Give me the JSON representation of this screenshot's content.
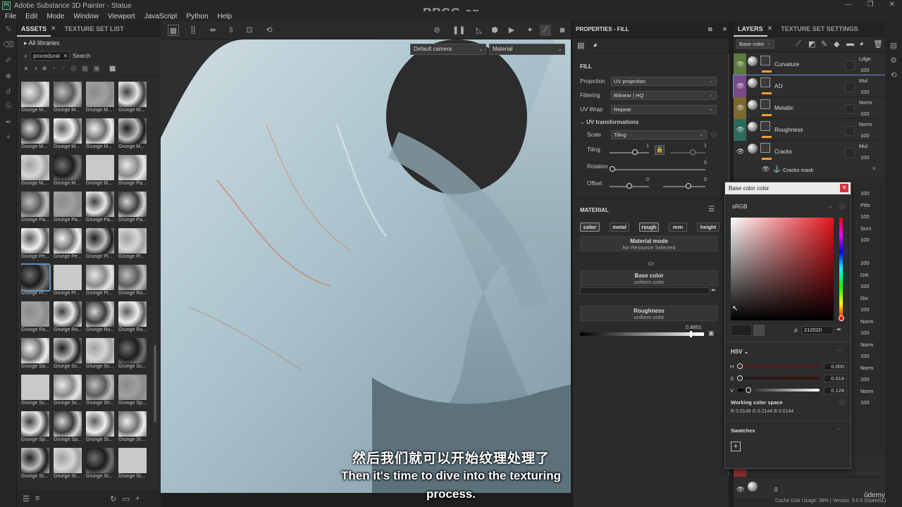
{
  "titlebar": {
    "app_title": "Adobe Substance 3D Painter - Statue",
    "logo": "Pt",
    "buttons": [
      "—",
      "❐",
      "✕"
    ]
  },
  "menu": [
    "File",
    "Edit",
    "Mode",
    "Window",
    "Viewport",
    "JavaScript",
    "Python",
    "Help"
  ],
  "watermark": "RRCG.cn",
  "assets": {
    "tabs": [
      "ASSETS",
      "TEXTURE SET LIST"
    ],
    "all_libraries": "All libraries",
    "search_value": "procedural",
    "search_label": "Search",
    "thumbnails": [
      "Grunge M...",
      "Grunge M...",
      "Grunge M...",
      "Grunge M...",
      "Grunge M...",
      "Grunge M...",
      "Grunge M...",
      "Grunge M...",
      "Grunge M...",
      "Grunge M...",
      "Grunge M...",
      "Grunge Pa...",
      "Grunge Pa...",
      "Grunge Pa...",
      "Grunge Pa...",
      "Grunge Pa...",
      "Grunge Pe...",
      "Grunge Pe...",
      "Grunge Pl...",
      "Grunge Pl...",
      "Grunge Pl...",
      "Grunge Pl...",
      "Grunge Pl...",
      "Grunge Ro...",
      "Grunge Ro...",
      "Grunge Ro...",
      "Grunge Ru...",
      "Grunge Ru...",
      "Grunge Sa...",
      "Grunge Sc...",
      "Grunge Sc...",
      "Grunge Sc...",
      "Grunge Sc...",
      "Grunge Sc...",
      "Grunge Sh...",
      "Grunge Sp...",
      "Grunge Sp...",
      "Grunge Sp...",
      "Grunge St...",
      "Grunge St...",
      "Grunge St...",
      "Grunge St...",
      "Grunge St...",
      "Grunge St..."
    ],
    "selected_index": 20
  },
  "viewport": {
    "camera": "Default camera",
    "mode": "Material"
  },
  "properties": {
    "header": "PROPERTIES - FILL",
    "fill_label": "FILL",
    "projection_label": "Projection",
    "projection_value": "UV projection",
    "filtering_label": "Filtering",
    "filtering_value": "Bilinear | HQ",
    "uvwrap_label": "UV Wrap",
    "uvwrap_value": "Repeat",
    "uvtrans_label": "UV transformations",
    "scale_label": "Scale",
    "scale_value": "Tiling",
    "tiling_label": "Tiling",
    "tiling_value": "1",
    "rotation_label": "Rotation",
    "rotation_value": "0",
    "offset_label": "Offset",
    "offset_x": "0",
    "offset_y": "0",
    "material_label": "MATERIAL",
    "channels": [
      "color",
      "metal",
      "rough",
      "nrm",
      "height"
    ],
    "material_mode_title": "Material mode",
    "material_mode_value": "No Resource Selected",
    "or_label": "Or",
    "basecolor_title": "Base color",
    "basecolor_value": "uniform color",
    "roughness_title": "Roughness",
    "roughness_value": "uniform color",
    "roughness_number": "0.8851",
    "roughness_level": 0.8851
  },
  "layers": {
    "tabs": [
      "LAYERS",
      "TEXTURE SET SETTINGS"
    ],
    "channel_select": "Base color",
    "items": [
      {
        "name": "Curvature",
        "blend": "Ldge",
        "opacity": "100",
        "color": "#5a7a3e"
      },
      {
        "name": "AO",
        "blend": "Mul",
        "opacity": "100",
        "color": "#7a4a8a"
      },
      {
        "name": "Metallic",
        "blend": "Norm",
        "opacity": "100",
        "color": "#7a6a2e"
      },
      {
        "name": "Roughness",
        "blend": "Norm",
        "opacity": "100",
        "color": "#2e6a5a"
      },
      {
        "name": "Cracks",
        "blend": "Mul",
        "opacity": "100",
        "color": "#2e2e2e"
      }
    ],
    "mask_name": "Cracks mask",
    "right_column": [
      {
        "blend": "",
        "op": "100"
      },
      {
        "blend": "Pthr",
        "op": "100"
      },
      {
        "blend": "Scrn",
        "op": "100"
      },
      {
        "blend": "",
        "op": "100"
      },
      {
        "blend": "Drk",
        "op": "100"
      },
      {
        "blend": "Div",
        "op": "100"
      },
      {
        "blend": "Norm",
        "op": "100"
      },
      {
        "blend": "Norm",
        "op": "100"
      },
      {
        "blend": "Norm",
        "op": "100"
      },
      {
        "blend": "Norm",
        "op": "100"
      }
    ],
    "bottom_layer_name": "0"
  },
  "picker": {
    "title": "Base color color",
    "colorspace": "sRGB",
    "hex_label": "#",
    "hex_value": "212020",
    "mode": "HSV",
    "h_label": "H",
    "h_value": "0.000",
    "s_label": "S",
    "s_value": "0.018",
    "v_label": "V",
    "v_value": "0.128",
    "working_label": "Working color space",
    "working_values": "R 0.0149  G 0.0144  B 0.0144",
    "swatches_label": "Swatches"
  },
  "subtitles": {
    "cn": "然后我们就可以开始纹理处理了",
    "en_line1": "Then it's time to dive into the texturing",
    "en_line2": "process."
  },
  "status": {
    "text": "Cache Disk Usage:   38%  |  Version: 9.0.0 (OpenGL)",
    "brand": "ûdemy"
  }
}
